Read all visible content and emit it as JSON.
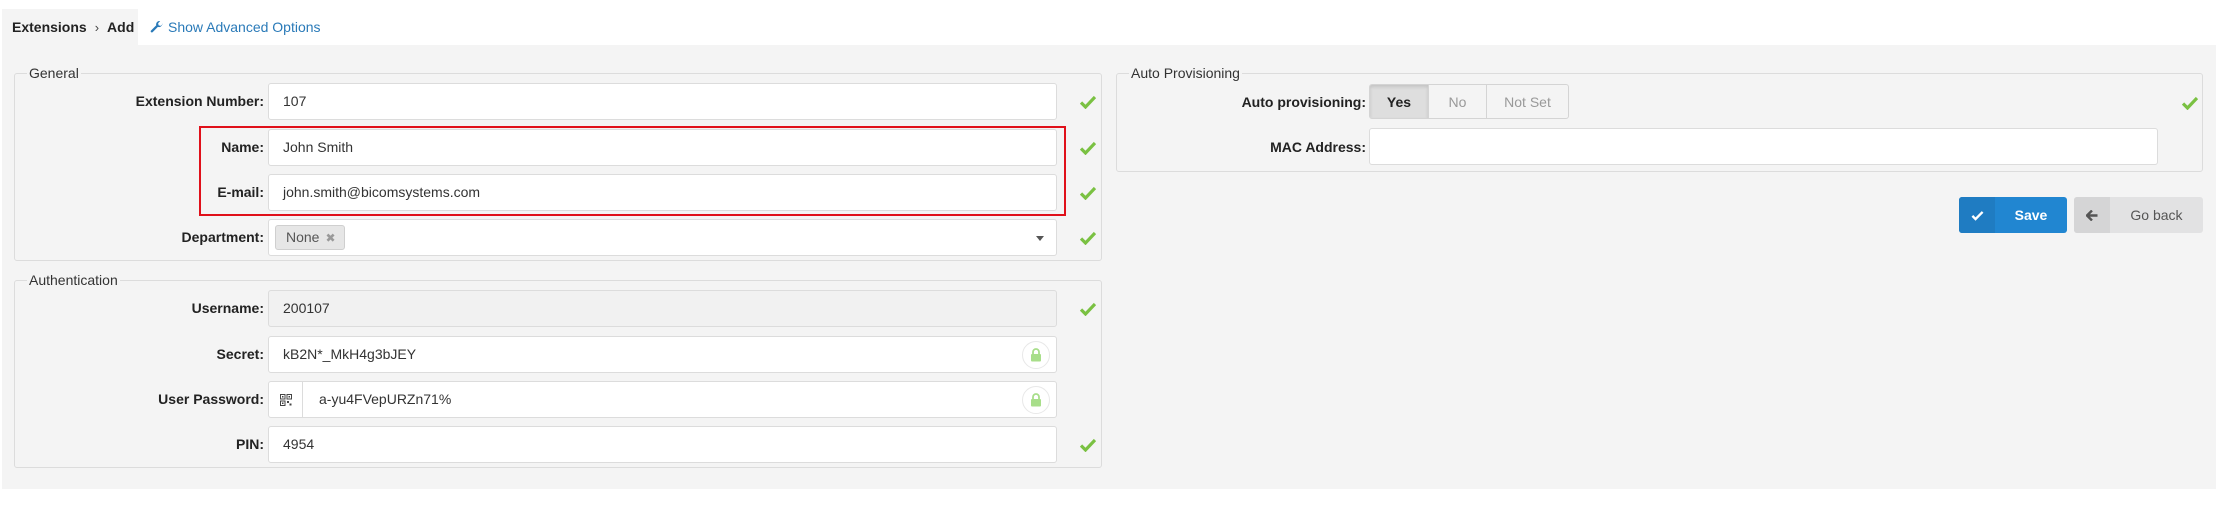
{
  "breadcrumb": {
    "parent": "Extensions",
    "separator": "›",
    "current": "Add"
  },
  "advanced_link": {
    "label": "Show Advanced Options",
    "icon": "wrench-icon"
  },
  "general": {
    "legend": "General",
    "extension_number": {
      "label": "Extension Number:",
      "value": "107",
      "valid": true
    },
    "name": {
      "label": "Name:",
      "value": "John Smith",
      "valid": true
    },
    "email": {
      "label": "E-mail:",
      "value": "john.smith@bicomsystems.com",
      "valid": true
    },
    "department": {
      "label": "Department:",
      "selected": "None",
      "remove_glyph": "✖",
      "valid": true
    }
  },
  "authentication": {
    "legend": "Authentication",
    "username": {
      "label": "Username:",
      "value": "200107",
      "valid": true
    },
    "secret": {
      "label": "Secret:",
      "value": "kB2N*_MkH4g3bJEY",
      "icon": "lock-icon"
    },
    "user_password": {
      "label": "User Password:",
      "value": "a-yu4FVepURZn71%",
      "addon_icon": "qr-code-icon",
      "icon": "lock-icon"
    },
    "pin": {
      "label": "PIN:",
      "value": "4954",
      "valid": true
    }
  },
  "auto_provisioning": {
    "legend": "Auto Provisioning",
    "auto_provisioning": {
      "label": "Auto provisioning:",
      "options": [
        "Yes",
        "No",
        "Not Set"
      ],
      "selected": "Yes",
      "valid": true
    },
    "mac_address": {
      "label": "MAC Address:",
      "value": ""
    }
  },
  "actions": {
    "save": "Save",
    "go_back": "Go back"
  },
  "colors": {
    "accent": "#2186d1",
    "valid": "#7ac142",
    "highlight": "#e0101a",
    "link": "#2a7ab8"
  }
}
